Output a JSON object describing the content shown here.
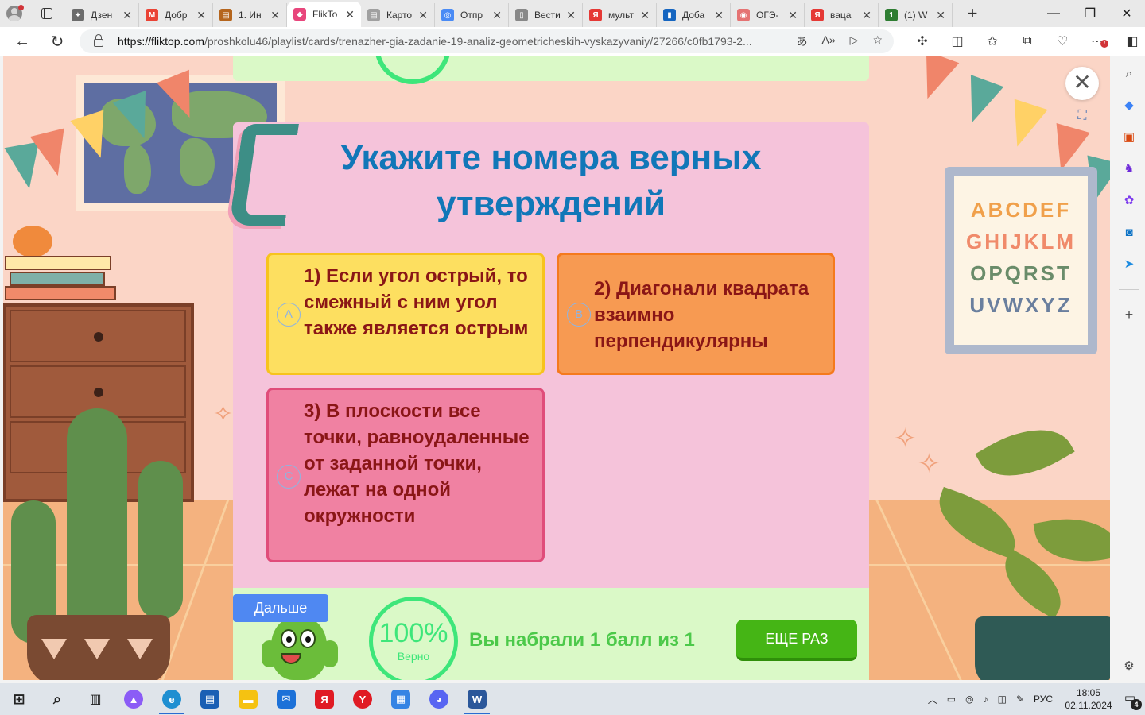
{
  "browser": {
    "tabs": [
      {
        "label": "Дзен",
        "fav_color": "#6b6b6b",
        "fav_glyph": "✦"
      },
      {
        "label": "Добр",
        "fav_color": "#ea4335",
        "fav_glyph": "M"
      },
      {
        "label": "1. Ин",
        "fav_color": "#b5651d",
        "fav_glyph": "▤"
      },
      {
        "label": "FlikTo",
        "fav_color": "#e8467c",
        "fav_glyph": "◆",
        "active": true
      },
      {
        "label": "Карто",
        "fav_color": "#a0a0a0",
        "fav_glyph": "▤"
      },
      {
        "label": "Отпр",
        "fav_color": "#4a8bf5",
        "fav_glyph": "◎"
      },
      {
        "label": "Вести",
        "fav_color": "#888888",
        "fav_glyph": "▯"
      },
      {
        "label": "мульт",
        "fav_color": "#e53935",
        "fav_glyph": "Я"
      },
      {
        "label": "Доба",
        "fav_color": "#1565c0",
        "fav_glyph": "▮"
      },
      {
        "label": "ОГЭ-",
        "fav_color": "#e57373",
        "fav_glyph": "◉"
      },
      {
        "label": "ваца",
        "fav_color": "#e53935",
        "fav_glyph": "Я"
      },
      {
        "label": "(1) W",
        "fav_color": "#2e7d32",
        "fav_glyph": "1"
      }
    ],
    "url_domain": "https://fliktop.com",
    "url_path": "/proshkolu46/playlist/cards/trenazher-gia-zadanie-19-analiz-geometricheskih-vyskazyvaniy/27266/c0fb1793-2...",
    "extension_badge": "1"
  },
  "quiz": {
    "title": "Укажите номера верных утверждений",
    "options": [
      {
        "letter": "A",
        "text": "1) Если угол острый, то смежный с ним угол также является острым"
      },
      {
        "letter": "B",
        "text": "2) Диагонали квадрата взаимно перпендикулярны"
      },
      {
        "letter": "C",
        "text": "3) В плоскости все точки, равноудаленные от заданной точки, лежат на одной окружности"
      }
    ],
    "next_label": "Дальше",
    "percent": "100%",
    "percent_label": "Верно",
    "score_text": "Вы набрали 1 балл из 1",
    "retry_label": "ЕЩЕ РАЗ"
  },
  "decor": {
    "alphabet_rows": [
      "ABCDEF",
      "GHIJKLM",
      "OPQRST",
      "UVWXYZ"
    ]
  },
  "taskbar": {
    "lang": "РУС",
    "time": "18:05",
    "date": "02.11.2024",
    "notifications": "4"
  },
  "colors": {
    "title_blue": "#1177b8",
    "option_yellow": "#fddf60",
    "option_orange": "#f79a52",
    "option_pink": "#f081a2",
    "success_green": "#3ee67a",
    "retry_green": "#45b515"
  }
}
